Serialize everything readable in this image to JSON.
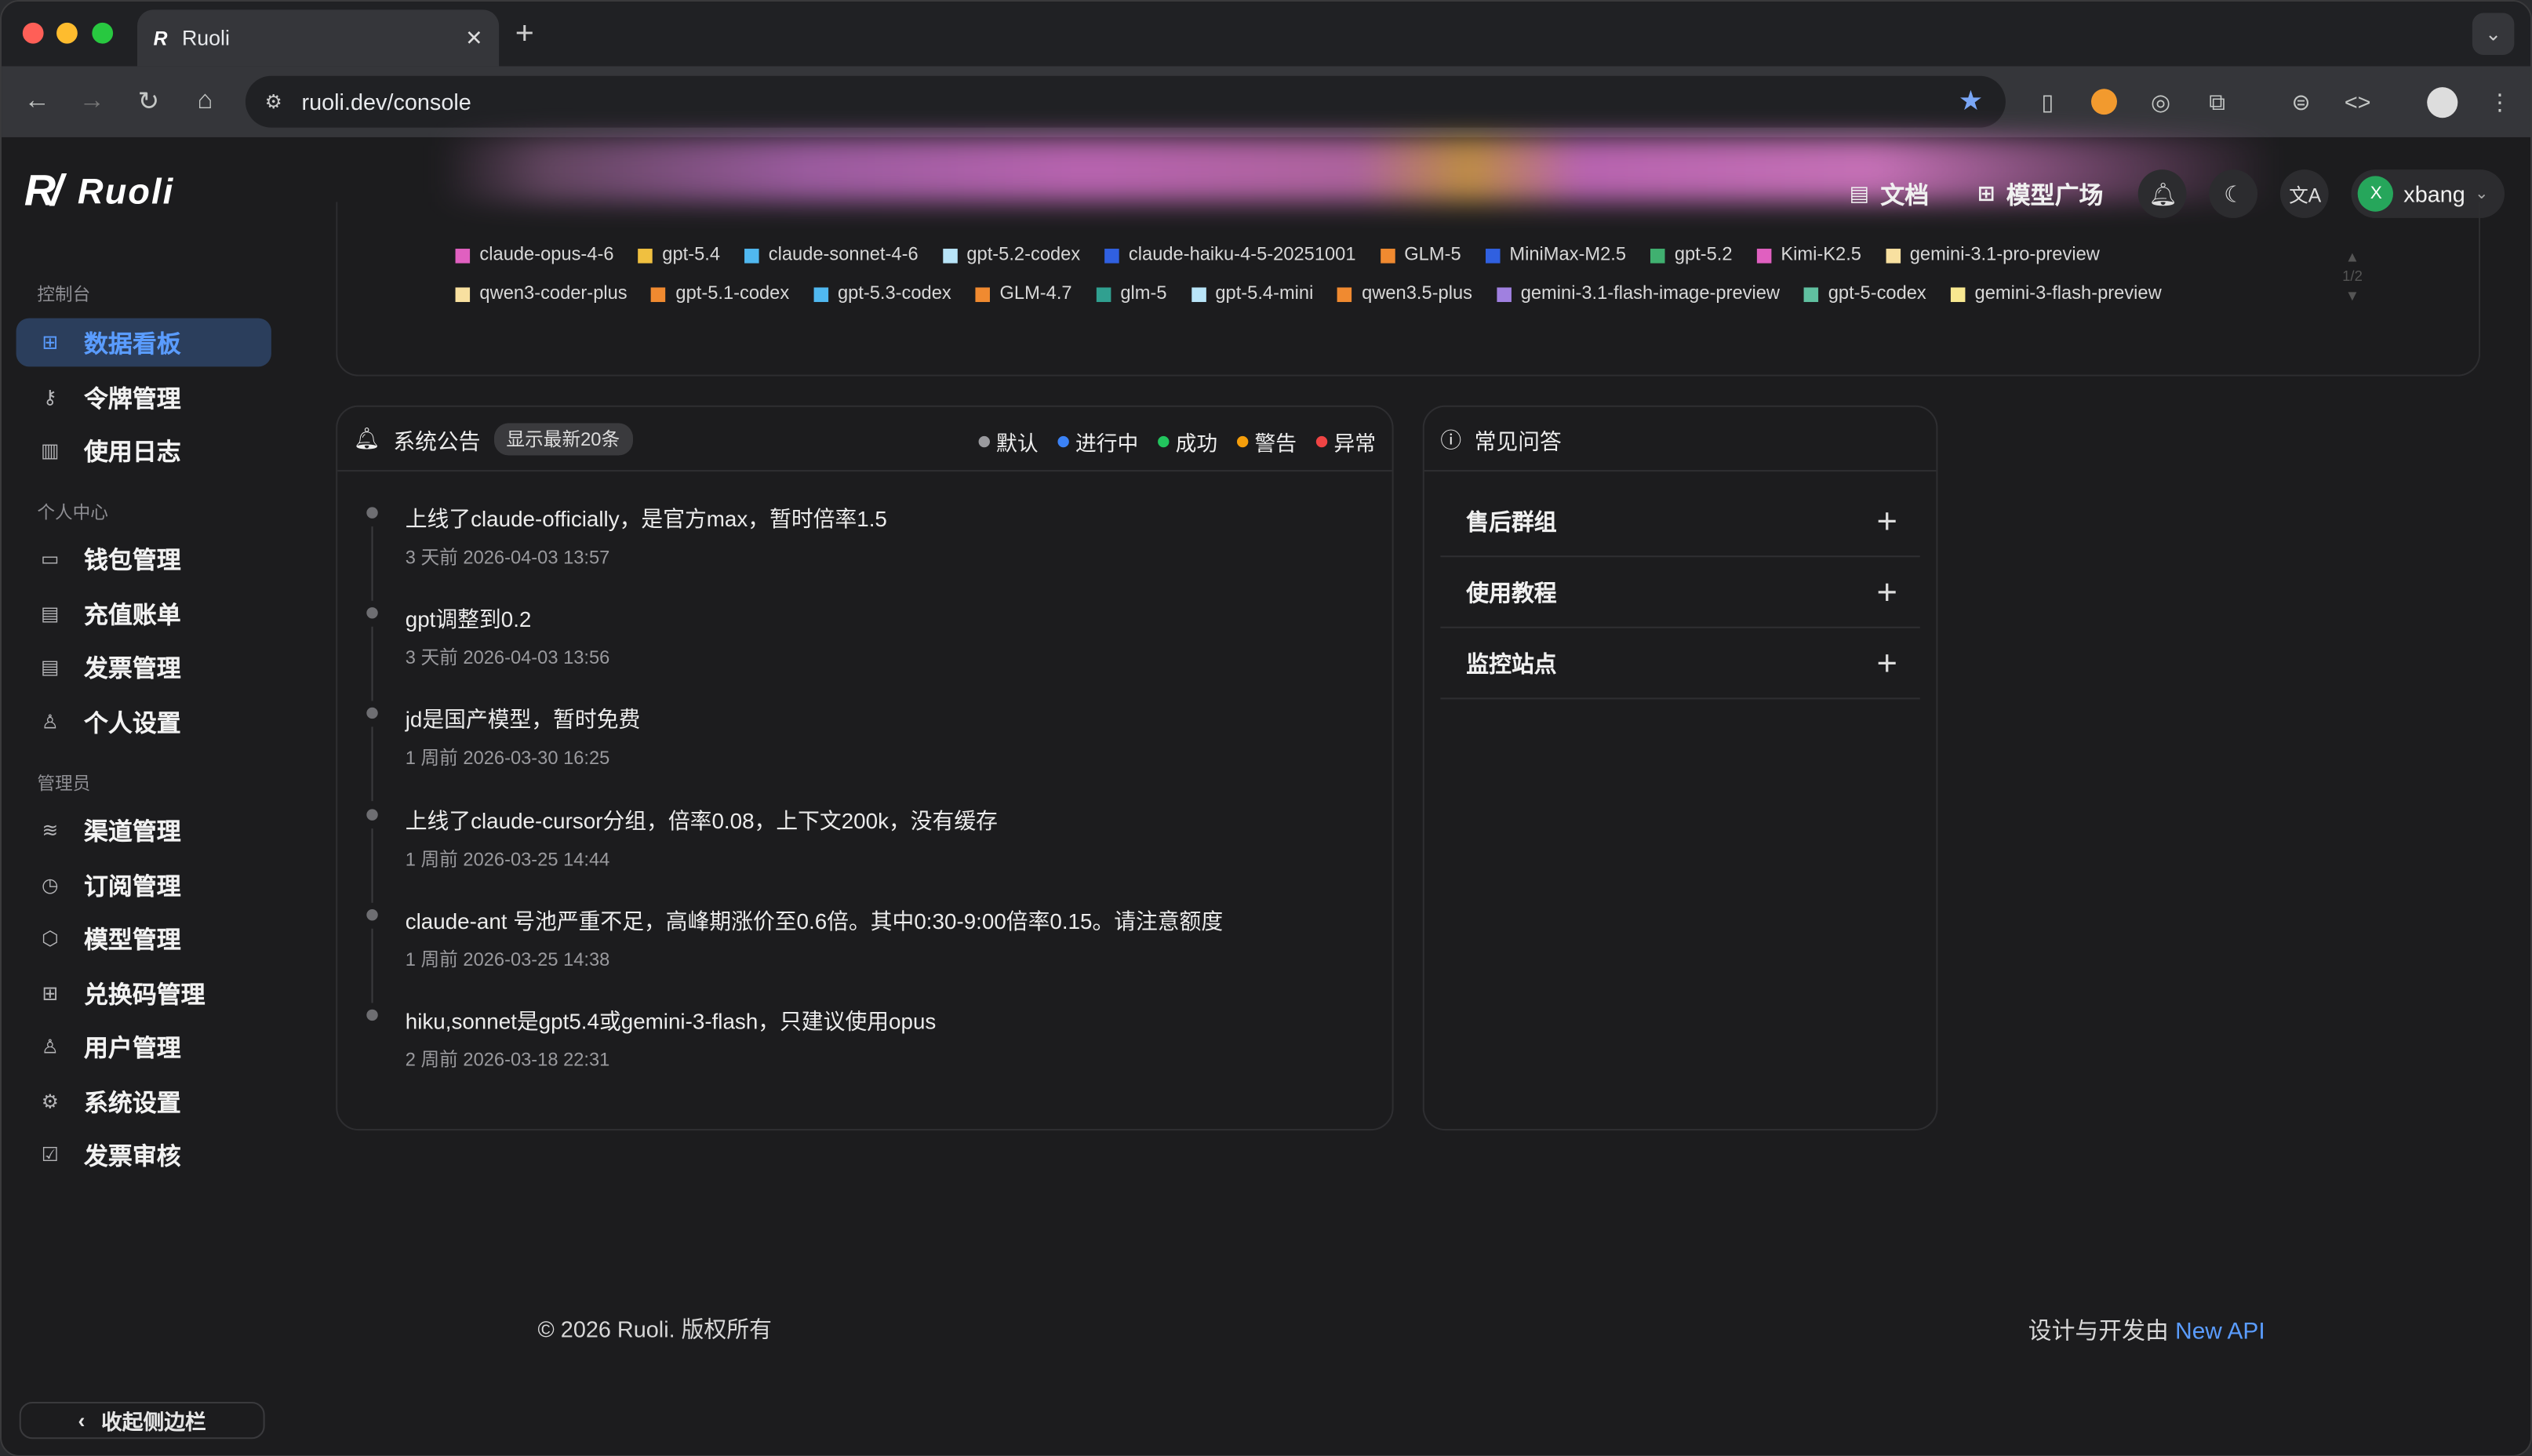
{
  "browser": {
    "tab_title": "Ruoli",
    "url": "ruoli.dev/console"
  },
  "sidebar": {
    "logo_text": "Ruoli",
    "sections": [
      {
        "label": "控制台",
        "items": [
          {
            "label": "数据看板",
            "icon": "grid-icon",
            "active": true
          },
          {
            "label": "令牌管理",
            "icon": "key-icon"
          },
          {
            "label": "使用日志",
            "icon": "chart-icon"
          }
        ]
      },
      {
        "label": "个人中心",
        "items": [
          {
            "label": "钱包管理",
            "icon": "wallet-icon"
          },
          {
            "label": "充值账单",
            "icon": "receipt-icon"
          },
          {
            "label": "发票管理",
            "icon": "invoice-icon"
          },
          {
            "label": "个人设置",
            "icon": "user-icon"
          }
        ]
      },
      {
        "label": "管理员",
        "items": [
          {
            "label": "渠道管理",
            "icon": "layers-icon"
          },
          {
            "label": "订阅管理",
            "icon": "calendar-icon"
          },
          {
            "label": "模型管理",
            "icon": "cube-icon"
          },
          {
            "label": "兑换码管理",
            "icon": "gift-icon"
          },
          {
            "label": "用户管理",
            "icon": "user-icon"
          },
          {
            "label": "系统设置",
            "icon": "gear-icon"
          },
          {
            "label": "发票审核",
            "icon": "clipboard-check-icon"
          }
        ]
      }
    ],
    "collapse_label": "收起侧边栏"
  },
  "header": {
    "docs_label": "文档",
    "models_label": "模型广场",
    "user_initial": "X",
    "username": "xbang"
  },
  "models": {
    "row1": [
      {
        "name": "claude-opus-4-6",
        "color": "#e060c0"
      },
      {
        "name": "gpt-5.4",
        "color": "#f0c040"
      },
      {
        "name": "claude-sonnet-4-6",
        "color": "#50b8f0"
      },
      {
        "name": "gpt-5.2-codex",
        "color": "#b8e4f8"
      },
      {
        "name": "claude-haiku-4-5-20251001",
        "color": "#3060e0"
      },
      {
        "name": "GLM-5",
        "color": "#f08a30"
      },
      {
        "name": "MiniMax-M2.5",
        "color": "#3060e0"
      },
      {
        "name": "gpt-5.2",
        "color": "#40b070"
      },
      {
        "name": "Kimi-K2.5",
        "color": "#e060c0"
      },
      {
        "name": "gemini-3.1-pro-preview",
        "color": "#f8e0a0"
      }
    ],
    "row2": [
      {
        "name": "qwen3-coder-plus",
        "color": "#f8e0a0"
      },
      {
        "name": "gpt-5.1-codex",
        "color": "#f08a30"
      },
      {
        "name": "gpt-5.3-codex",
        "color": "#50b8f0"
      },
      {
        "name": "GLM-4.7",
        "color": "#f08a30"
      },
      {
        "name": "glm-5",
        "color": "#30a090"
      },
      {
        "name": "gpt-5.4-mini",
        "color": "#b8e4f8"
      },
      {
        "name": "qwen3.5-plus",
        "color": "#f08a30"
      },
      {
        "name": "gemini-3.1-flash-image-preview",
        "color": "#a080e0"
      },
      {
        "name": "gpt-5-codex",
        "color": "#60c0a0"
      },
      {
        "name": "gemini-3-flash-preview",
        "color": "#f8e890"
      }
    ],
    "pager": "1/2"
  },
  "announcements": {
    "title": "系统公告",
    "badge": "显示最新20条",
    "legend": [
      {
        "label": "默认",
        "color": "#9a9a9e"
      },
      {
        "label": "进行中",
        "color": "#3b82f6"
      },
      {
        "label": "成功",
        "color": "#22c55e"
      },
      {
        "label": "警告",
        "color": "#f59e0b"
      },
      {
        "label": "异常",
        "color": "#ef4444"
      }
    ],
    "items": [
      {
        "text": "上线了claude-officially，是官方max，暂时倍率1.5",
        "date": "3 天前 2026-04-03 13:57"
      },
      {
        "text": "gpt调整到0.2",
        "date": "3 天前 2026-04-03 13:56"
      },
      {
        "text": "jd是国产模型，暂时免费",
        "date": "1 周前 2026-03-30 16:25"
      },
      {
        "text": "上线了claude-cursor分组，倍率0.08，上下文200k，没有缓存",
        "date": "1 周前 2026-03-25 14:44"
      },
      {
        "text": "claude-ant 号池严重不足，高峰期涨价至0.6倍。其中0:30-9:00倍率0.15。请注意额度",
        "date": "1 周前 2026-03-25 14:38"
      },
      {
        "text": "hiku,sonnet是gpt5.4或gemini-3-flash，只建议使用opus",
        "date": "2 周前 2026-03-18 22:31"
      }
    ]
  },
  "faq": {
    "title": "常见问答",
    "items": [
      "售后群组",
      "使用教程",
      "监控站点"
    ]
  },
  "footer": {
    "copyright": "© 2026 Ruoli. 版权所有",
    "credit_prefix": "设计与开发由",
    "credit_link": "New API"
  }
}
